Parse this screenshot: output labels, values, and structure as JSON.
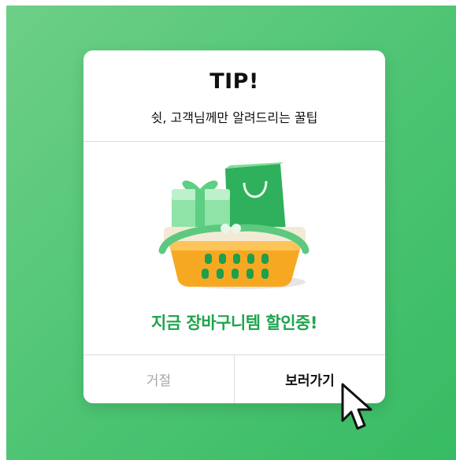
{
  "modal": {
    "title": "TIP!",
    "subtitle": "쉿, 고객님께만 알려드리는 꿀팁",
    "promo_text": "지금 장바구니템 할인중!",
    "buttons": {
      "reject_label": "거절",
      "view_label": "보러가기"
    }
  },
  "illustration": {
    "icon": "shopping-basket-with-gifts"
  },
  "colors": {
    "background_green": "#4cc472",
    "promo_green": "#1fa44d",
    "promo_highlight": "#d4f2dd",
    "basket_orange": "#f7a823",
    "reject_gray": "#a6a6a6"
  }
}
